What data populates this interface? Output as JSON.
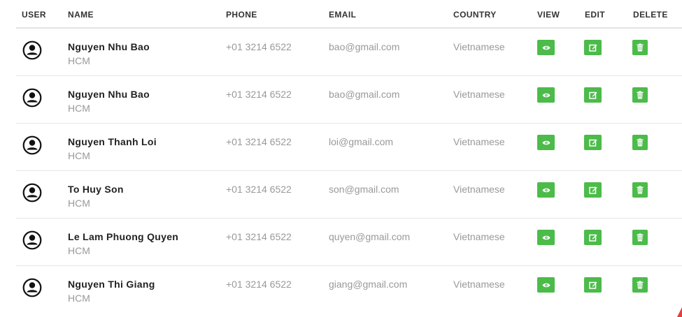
{
  "headers": {
    "user": "USER",
    "name": "NAME",
    "phone": "PHONE",
    "email": "EMAIL",
    "country": "COUNTRY",
    "view": "VIEW",
    "edit": "EDIT",
    "delete": "DELETE"
  },
  "rows": [
    {
      "name": "Nguyen Nhu Bao",
      "city": "HCM",
      "phone": "+01 3214 6522",
      "email": "bao@gmail.com",
      "country": "Vietnamese"
    },
    {
      "name": "Nguyen Nhu Bao",
      "city": "HCM",
      "phone": "+01 3214 6522",
      "email": "bao@gmail.com",
      "country": "Vietnamese"
    },
    {
      "name": "Nguyen Thanh Loi",
      "city": "HCM",
      "phone": "+01 3214 6522",
      "email": "loi@gmail.com",
      "country": "Vietnamese"
    },
    {
      "name": "To Huy Son",
      "city": "HCM",
      "phone": "+01 3214 6522",
      "email": "son@gmail.com",
      "country": "Vietnamese"
    },
    {
      "name": "Le Lam Phuong Quyen",
      "city": "HCM",
      "phone": "+01 3214 6522",
      "email": "quyen@gmail.com",
      "country": "Vietnamese"
    },
    {
      "name": "Nguyen Thi Giang",
      "city": "HCM",
      "phone": "+01 3214 6522",
      "email": "giang@gmail.com",
      "country": "Vietnamese"
    }
  ],
  "icons": {
    "avatar": "user-circle-icon",
    "view": "eye-icon",
    "edit": "edit-icon",
    "delete": "trash-icon"
  },
  "colors": {
    "action_button": "#4cbb4a",
    "header_text": "#333333",
    "muted_text": "#999999"
  }
}
